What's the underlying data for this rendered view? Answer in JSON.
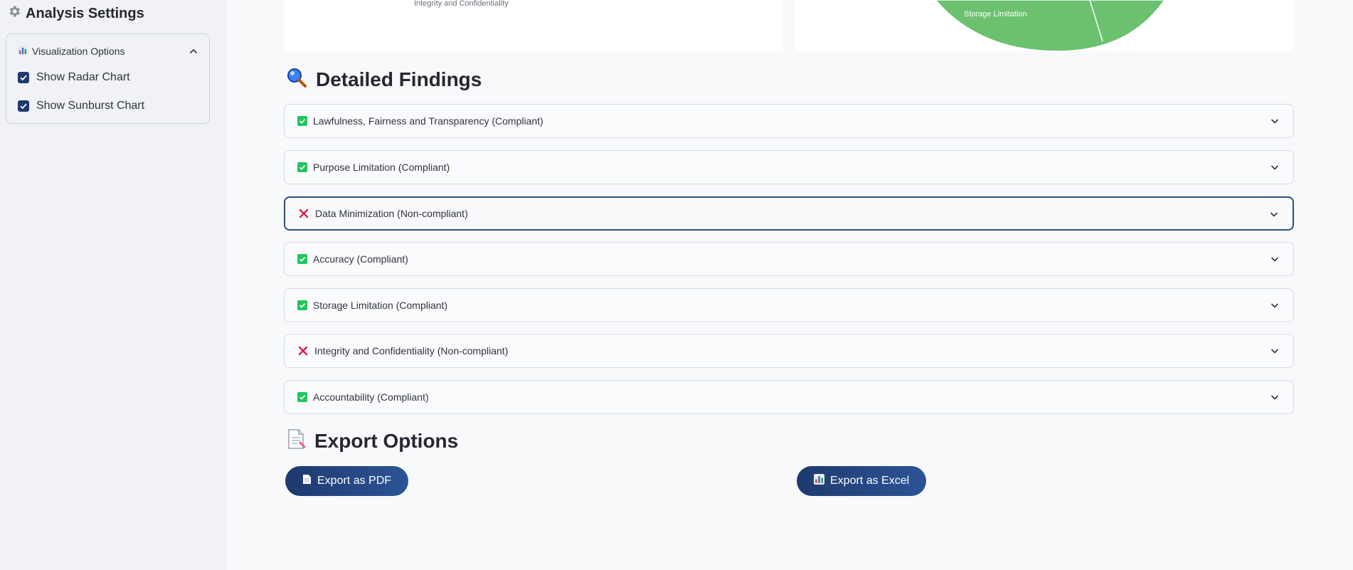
{
  "sidebar": {
    "title": "Analysis Settings",
    "title_icon": "gear-icon",
    "expander": {
      "label": "Visualization Options",
      "icon": "bar-chart-icon",
      "expanded": true,
      "options": [
        {
          "label": "Show Radar Chart",
          "checked": true
        },
        {
          "label": "Show Sunburst Chart",
          "checked": true
        }
      ]
    }
  },
  "charts": {
    "radar_visible_label": "Integrity and Confidentiality",
    "sunburst_visible_label": "Storage Limitation",
    "sunburst_color": "#6cc16f"
  },
  "findings": {
    "title": "Detailed Findings",
    "title_icon": "magnifier-icon",
    "items": [
      {
        "label": "Lawfulness, Fairness and Transparency (Compliant)",
        "status": "compliant"
      },
      {
        "label": "Purpose Limitation (Compliant)",
        "status": "compliant"
      },
      {
        "label": "Data Minimization (Non-compliant)",
        "status": "non-compliant"
      },
      {
        "label": "Accuracy (Compliant)",
        "status": "compliant"
      },
      {
        "label": "Storage Limitation (Compliant)",
        "status": "compliant"
      },
      {
        "label": "Integrity and Confidentiality (Non-compliant)",
        "status": "non-compliant"
      },
      {
        "label": "Accountability (Compliant)",
        "status": "compliant"
      }
    ]
  },
  "export": {
    "title": "Export Options",
    "title_icon": "document-icon",
    "pdf_label": "Export as PDF",
    "excel_label": "Export as Excel"
  },
  "colors": {
    "accent": "#1e3a6e",
    "compliant": "#22c55e",
    "non_compliant": "#e11d48"
  }
}
